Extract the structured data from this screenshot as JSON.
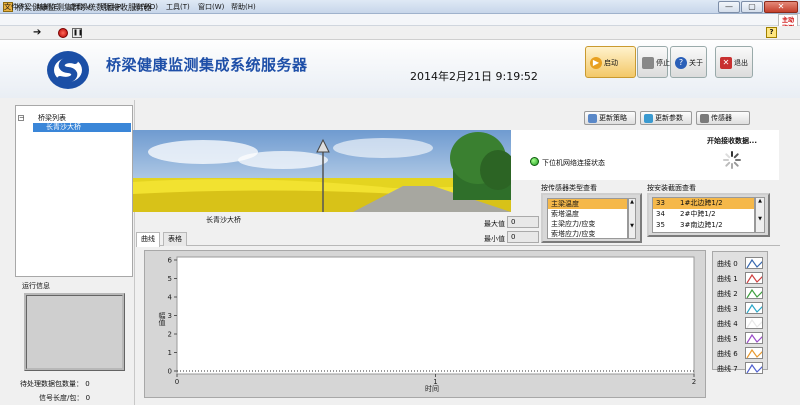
{
  "window": {
    "title": "桥梁健康监测集群系统数据接收服务器",
    "min_label": "—",
    "max_label": "▢",
    "close_label": "✕"
  },
  "menu": [
    "文件(F)",
    "编辑(E)",
    "查看(V)",
    "项目(P)",
    "操作(O)",
    "工具(T)",
    "窗口(W)",
    "帮助(H)"
  ],
  "corner_logo": "主动\n监测",
  "header": {
    "title": "桥梁健康监测集成系统服务器",
    "datetime": "2014年2月21日 9:19:52",
    "buttons": {
      "start": "启动",
      "stop": "停止",
      "about": "关于",
      "exit": "退出"
    }
  },
  "tree": {
    "root": "桥梁列表",
    "child": "长青沙大桥"
  },
  "actions": {
    "strategy": "更新策略",
    "params": "更新参数",
    "sensor": "传感器"
  },
  "banner": {
    "bridge_name": "长青沙大桥"
  },
  "status": {
    "start_receiving": "开始接收数据...",
    "connection": "下位机网络连接状态"
  },
  "sensor_types": {
    "title": "按传感器类型查看",
    "items": [
      "主梁温度",
      "索塔温度",
      "主梁应力/应变",
      "索塔应力/应变"
    ],
    "selected_index": 0
  },
  "install_sections": {
    "title": "按安装截面查看",
    "rows": [
      {
        "num": "33",
        "name": "1#北边跨1/2"
      },
      {
        "num": "34",
        "name": "2#中跨1/2"
      },
      {
        "num": "35",
        "name": "3#南边跨1/2"
      }
    ],
    "selected_index": 0
  },
  "stats": {
    "max_label": "最大值",
    "max_value": "0",
    "min_label": "最小值",
    "min_value": "0"
  },
  "tabs": {
    "curve": "曲线",
    "table": "表格"
  },
  "left_info": {
    "run_info": "运行信息",
    "pending": "待处理数据包数量： 0",
    "signal_len": "信号长度/包： 0"
  },
  "chart_data": {
    "type": "line",
    "title": "",
    "xlabel": "时间",
    "ylabel": "幅值",
    "xlim": [
      0,
      2
    ],
    "ylim": [
      0,
      6
    ],
    "x_ticks": [
      "0",
      "1",
      "2"
    ],
    "y_ticks": [
      "0",
      "1",
      "2",
      "3",
      "4",
      "5",
      "6"
    ],
    "grid": false,
    "series": [
      {
        "name": "曲线 0",
        "values": [],
        "color": "#3a6ab0"
      },
      {
        "name": "曲线 1",
        "values": [],
        "color": "#d04040"
      },
      {
        "name": "曲线 2",
        "values": [],
        "color": "#40a040"
      },
      {
        "name": "曲线 3",
        "values": [],
        "color": "#2aa6c8"
      },
      {
        "name": "曲线 4",
        "values": [],
        "color": "#e8e8e8"
      },
      {
        "name": "曲线 5",
        "values": [],
        "color": "#9a4ac8"
      },
      {
        "name": "曲线 6",
        "values": [],
        "color": "#e89a30"
      },
      {
        "name": "曲线 7",
        "values": [],
        "color": "#5060d0"
      }
    ]
  }
}
